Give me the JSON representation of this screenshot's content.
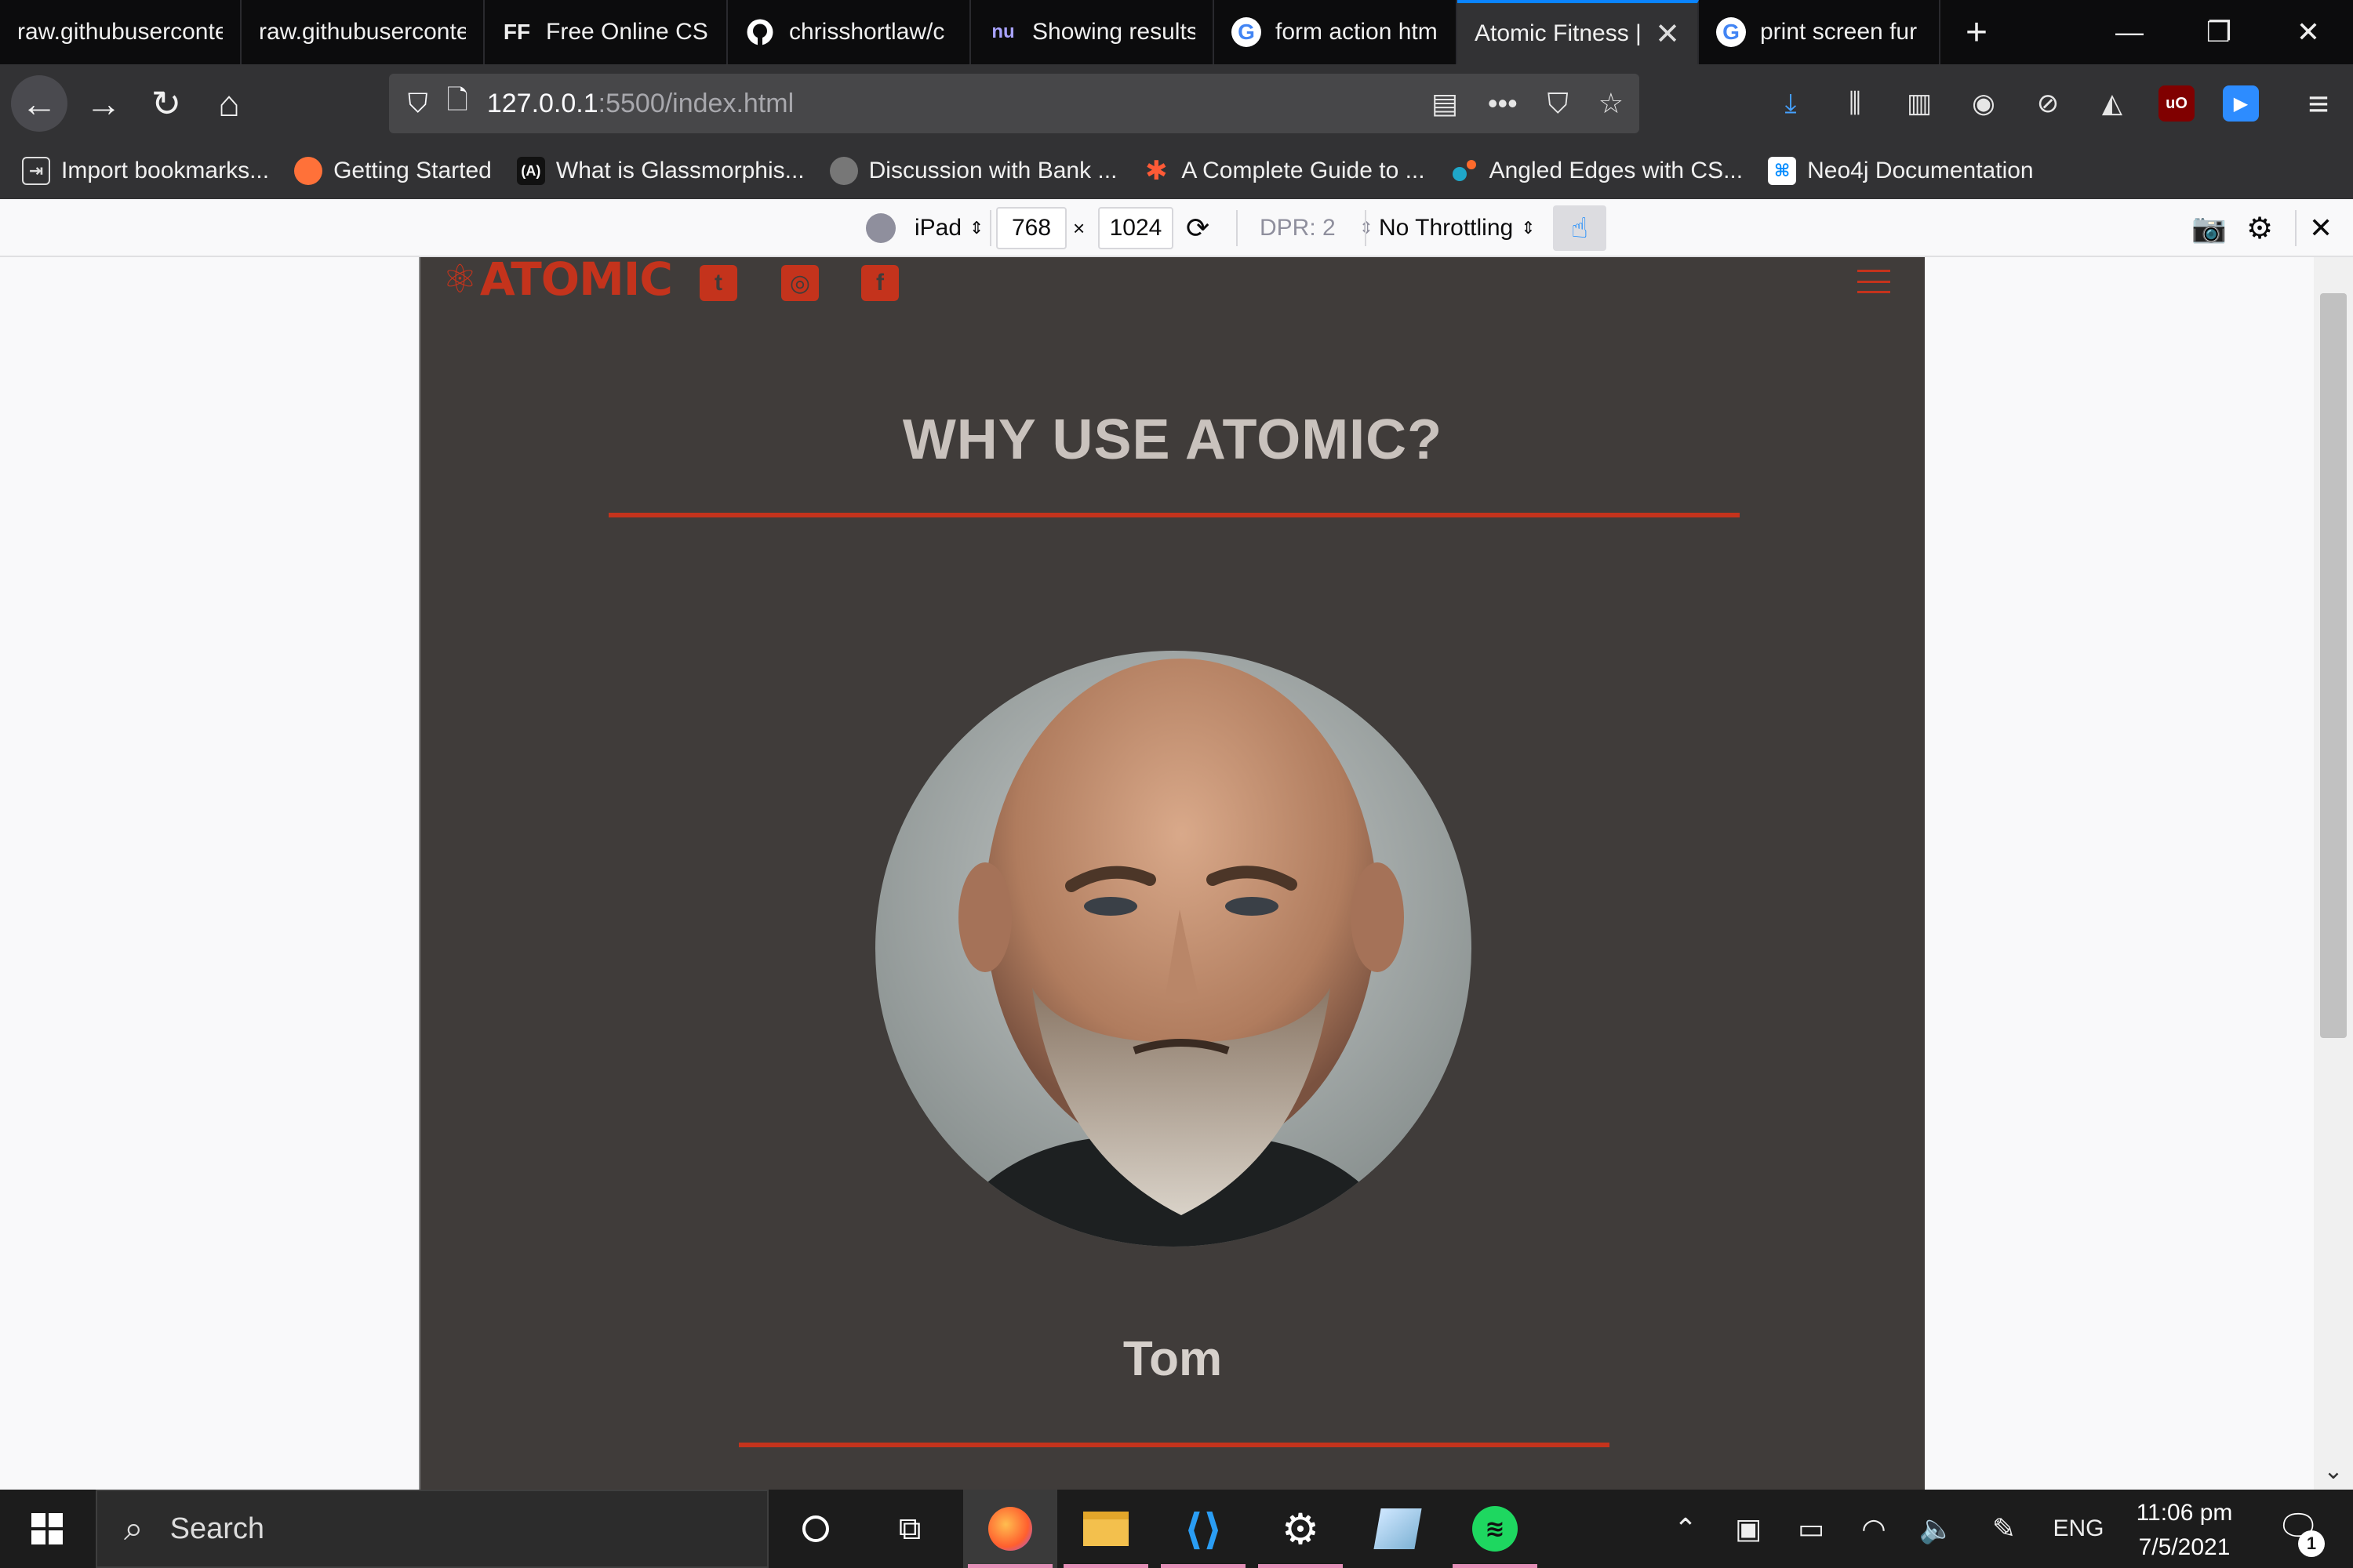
{
  "browser": {
    "tabs": [
      {
        "title": "raw.githubuserconte",
        "icon": "page-icon"
      },
      {
        "title": "raw.githubuserconte",
        "icon": "page-icon"
      },
      {
        "title": "Free Online CSS",
        "icon": "ff-logo-icon",
        "icon_text": "FF"
      },
      {
        "title": "chrisshortlaw/c",
        "icon": "github-icon"
      },
      {
        "title": "Showing results",
        "icon": "nu-icon",
        "icon_text": "nu"
      },
      {
        "title": "form action htm",
        "icon": "google-icon",
        "icon_text": "G"
      },
      {
        "title": "Atomic Fitness |",
        "icon": "none",
        "active": true
      },
      {
        "title": "print screen fur",
        "icon": "google-icon",
        "icon_text": "G"
      }
    ],
    "url": {
      "host": "127.0.0.1",
      "path": ":5500/index.html"
    },
    "bookmarks": [
      {
        "label": "Import bookmarks...",
        "icon": "import-icon"
      },
      {
        "label": "Getting Started",
        "icon": "firefox-icon"
      },
      {
        "label": "What is Glassmorphis...",
        "icon": "glass-icon",
        "icon_text": "(A)"
      },
      {
        "label": "Discussion with Bank ...",
        "icon": "discussion-icon"
      },
      {
        "label": "A Complete Guide to ...",
        "icon": "star-burst-icon"
      },
      {
        "label": "Angled Edges with CS...",
        "icon": "dots-icon"
      },
      {
        "label": "Neo4j Documentation",
        "icon": "neo4j-icon"
      }
    ]
  },
  "rdm": {
    "device": "iPad",
    "width": "768",
    "times": "×",
    "height": "1024",
    "dpr": "DPR: 2",
    "throttling": "No Throttling"
  },
  "site": {
    "logo": "ATOMIC",
    "social": [
      {
        "name": "twitter",
        "glyph": "t"
      },
      {
        "name": "instagram",
        "glyph": "◎"
      },
      {
        "name": "facebook",
        "glyph": "f"
      }
    ],
    "section_title": "WHY USE ATOMIC?",
    "person_name": "Tom",
    "accent_color": "#c4331c",
    "background_color": "#403c3a"
  },
  "taskbar": {
    "search_placeholder": "Search",
    "language": "ENG",
    "time": "11:06 pm",
    "date": "7/5/2021",
    "notification_count": "1"
  }
}
